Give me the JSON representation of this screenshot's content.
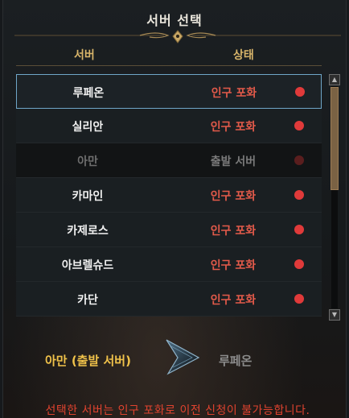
{
  "dialog": {
    "title": "서버 선택",
    "columns": {
      "server": "서버",
      "status": "상태"
    }
  },
  "servers": [
    {
      "name": "루페온",
      "status": "인구 포화",
      "selected": true,
      "disabled": false
    },
    {
      "name": "실리안",
      "status": "인구 포화",
      "selected": false,
      "disabled": false
    },
    {
      "name": "아만",
      "status": "출발 서버",
      "selected": false,
      "disabled": true
    },
    {
      "name": "카마인",
      "status": "인구 포화",
      "selected": false,
      "disabled": false
    },
    {
      "name": "카제로스",
      "status": "인구 포화",
      "selected": false,
      "disabled": false
    },
    {
      "name": "아브렐슈드",
      "status": "인구 포화",
      "selected": false,
      "disabled": false
    },
    {
      "name": "카단",
      "status": "인구 포화",
      "selected": false,
      "disabled": false
    }
  ],
  "transfer": {
    "from": "아만 (출발 서버)",
    "to": "루페온",
    "warning": "선택한 서버는 인구 포화로 이전 신청이 불가능합니다."
  },
  "colors": {
    "accent_gold": "#d8b56a",
    "status_full": "#e35a4a",
    "dot_red": "#e03a3a",
    "from_yellow": "#f0c24a",
    "selected_border": "#6fa6c8"
  }
}
